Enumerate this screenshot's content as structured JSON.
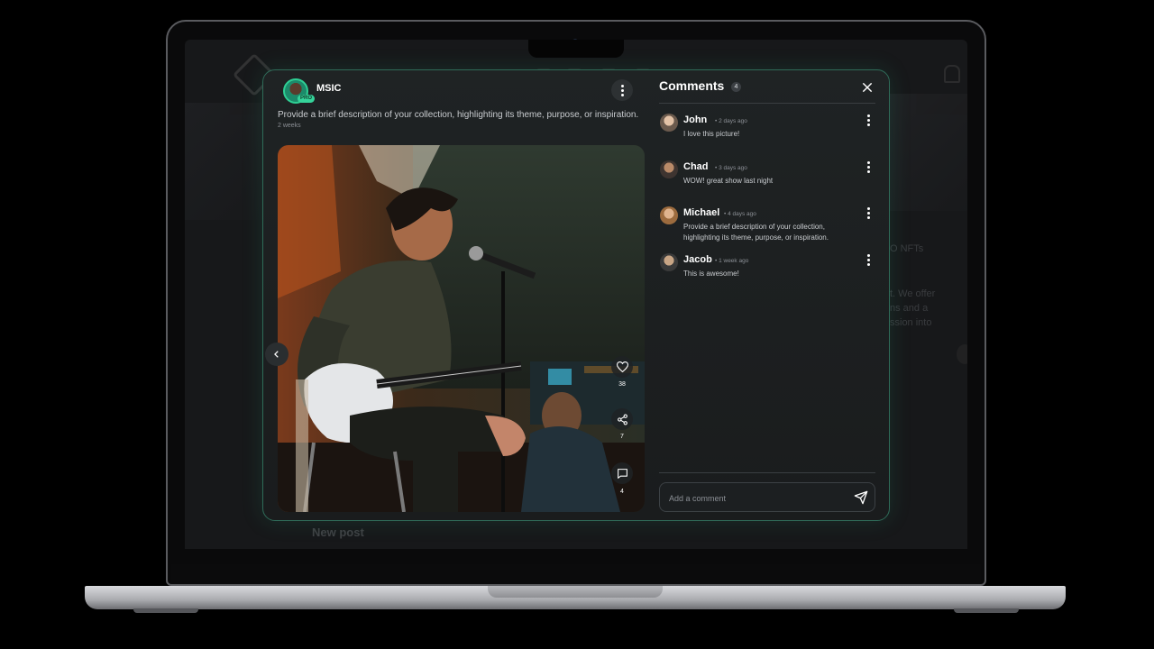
{
  "post": {
    "username": "MSIC",
    "badge": "PRO",
    "description": "Provide a brief description of your collection, highlighting its theme, purpose, or inspiration.",
    "time": "2 weeks",
    "likes": "38",
    "shares": "7",
    "comments": "4"
  },
  "comments_panel": {
    "title": "Comments",
    "count": "4",
    "items": [
      {
        "name": "John",
        "when": "• 2 days ago",
        "text": "I love this picture!"
      },
      {
        "name": "Chad",
        "when": "• 3 days ago",
        "text": "WOW! great show last night"
      },
      {
        "name": "Michael",
        "when": "• 4 days ago",
        "text": "Provide a brief description of your collection, highlighting its theme, purpose, or inspiration."
      },
      {
        "name": "Jacob",
        "when": "• 1 week ago",
        "text": "This is awesome!"
      }
    ],
    "input_placeholder": "Add a comment"
  },
  "background": {
    "new_post_label": "New post",
    "right_lines": [
      "O NFTs",
      "t. We offer",
      "ns and a",
      "ssion into"
    ]
  },
  "colors": {
    "accent": "#35d39a",
    "modal_border": "#2f6b58",
    "modal_bg": "#1e2122"
  },
  "icons": [
    "more-vertical-icon",
    "heart-icon",
    "share-icon",
    "comment-icon",
    "chevron-left-icon",
    "close-icon",
    "send-icon"
  ]
}
